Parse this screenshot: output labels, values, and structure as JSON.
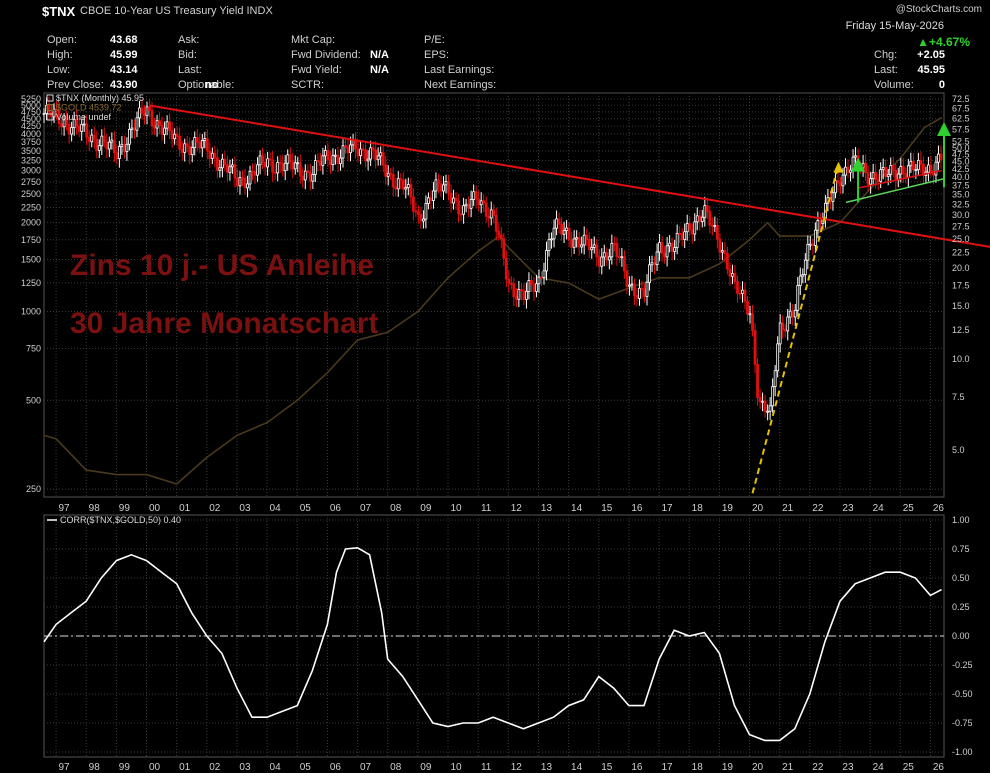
{
  "header": {
    "symbol": "$TNX",
    "description": "CBOE 10-Year US Treasury Yield INDX",
    "watermark": "@StockCharts.com",
    "date": "Friday 15-May-2026",
    "pct_change": "+4.67%",
    "col1": [
      {
        "label": "Open:",
        "value": "43.68"
      },
      {
        "label": "High:",
        "value": "45.99"
      },
      {
        "label": "Low:",
        "value": "43.14"
      },
      {
        "label": "Prev Close:",
        "value": "43.90"
      }
    ],
    "col2": [
      {
        "label": "Ask:",
        "value": ""
      },
      {
        "label": "Bid:",
        "value": ""
      },
      {
        "label": "Last:",
        "value": ""
      },
      {
        "label": "Optionable:",
        "value": "no"
      }
    ],
    "col3": [
      {
        "label": "Mkt Cap:",
        "value": ""
      },
      {
        "label": "Fwd Dividend:",
        "value": "N/A"
      },
      {
        "label": "Fwd Yield:",
        "value": "N/A"
      },
      {
        "label": "SCTR:",
        "value": ""
      }
    ],
    "col4": [
      {
        "label": "P/E:",
        "value": ""
      },
      {
        "label": "EPS:",
        "value": ""
      },
      {
        "label": "Last Earnings:",
        "value": ""
      },
      {
        "label": "Next Earnings:",
        "value": ""
      }
    ],
    "col5": [
      {
        "label": "",
        "value": ""
      },
      {
        "label": "Chg:",
        "value": "+2.05"
      },
      {
        "label": "Last:",
        "value": "45.95"
      },
      {
        "label": "Volume:",
        "value": "0"
      }
    ]
  },
  "legend": [
    {
      "text": "$TNX (Monthly) 45.95",
      "color": "#d9d9d9"
    },
    {
      "text": "$GOLD 4539.72",
      "color": "#8a6a30"
    },
    {
      "text": "Volume undef",
      "color": "#d9d9d9"
    }
  ],
  "overlay": {
    "line1": "Zins 10 j.- US Anleihe",
    "line2": "30 Jahre Monatschart",
    "color": "#7a1010"
  },
  "colors": {
    "background": "#000000",
    "grid": "#3a3a3a",
    "up_candle": "#ffffff",
    "down_candle": "#e01010",
    "trend_red": "#e01010",
    "trend_green": "#5cd65c",
    "arrow_green": "#2fd12f",
    "arrow_yellow": "#e6c200",
    "gold_line": "#4a3a1c",
    "corr_line": "#ffffff"
  },
  "chart_data": [
    {
      "type": "line",
      "title": "$TNX (Monthly)",
      "x_tick_labels": [
        "97",
        "98",
        "99",
        "00",
        "01",
        "02",
        "03",
        "04",
        "05",
        "06",
        "07",
        "08",
        "09",
        "10",
        "11",
        "12",
        "13",
        "14",
        "15",
        "16",
        "17",
        "18",
        "19",
        "20",
        "21",
        "22",
        "23",
        "24",
        "25",
        "26"
      ],
      "right_axis_ticks": [
        "72.5",
        "67.5",
        "62.5",
        "57.5",
        "52.5",
        "50.0",
        "47.5",
        "45.0",
        "42.5",
        "40.0",
        "37.5",
        "35.0",
        "32.5",
        "30.0",
        "27.5",
        "25.0",
        "22.5",
        "20.0",
        "17.5",
        "15.0",
        "12.5",
        "10.0",
        "7.5",
        "5.0"
      ],
      "left_axis_ticks": [
        "5250",
        "5000",
        "4750",
        "4500",
        "4250",
        "4000",
        "3750",
        "3500",
        "3250",
        "3000",
        "2750",
        "2500",
        "2250",
        "2000",
        "1750",
        "1500",
        "1250",
        "1000",
        "750",
        "500",
        "250"
      ],
      "series": [
        {
          "name": "$TNX",
          "x": [
            1996.6,
            1997,
            1997.5,
            1998,
            1998.5,
            1999,
            1999.5,
            2000,
            2000.5,
            2001,
            2001.5,
            2002,
            2002.5,
            2003,
            2003.5,
            2004,
            2004.5,
            2005,
            2005.5,
            2006,
            2006.5,
            2007,
            2007.5,
            2008,
            2008.5,
            2009,
            2009.5,
            2010,
            2010.5,
            2011,
            2011.5,
            2012,
            2012.5,
            2013,
            2013.5,
            2014,
            2014.5,
            2015,
            2015.5,
            2016,
            2016.5,
            2017,
            2017.5,
            2018,
            2018.5,
            2019,
            2019.5,
            2020,
            2020.3,
            2020.7,
            2021,
            2021.5,
            2022,
            2022.5,
            2023,
            2023.5,
            2024,
            2024.5,
            2025,
            2025.5,
            2026,
            2026.37
          ],
          "y": [
            65,
            63,
            60,
            55,
            53,
            47,
            58,
            66,
            59,
            52,
            51,
            50,
            44,
            39,
            41,
            45,
            44,
            43,
            41,
            47,
            48,
            50,
            48,
            41,
            38,
            29,
            36,
            37,
            30,
            35,
            29,
            18,
            16,
            18,
            27,
            26,
            24,
            22,
            23,
            18,
            16,
            24,
            23,
            28,
            30,
            25,
            17,
            15,
            7,
            6.5,
            13,
            14,
            25,
            30,
            41,
            44,
            41,
            40,
            43,
            42,
            43.5,
            45.95
          ]
        },
        {
          "name": "$GOLD",
          "x": [
            1996.6,
            1997,
            1998,
            1999,
            2000,
            2001,
            2002,
            2003,
            2004,
            2005,
            2006,
            2007,
            2008,
            2009,
            2010,
            2011,
            2011.7,
            2012,
            2013,
            2014,
            2015,
            2016,
            2017,
            2018,
            2019,
            2020,
            2020.6,
            2021,
            2022,
            2023,
            2024,
            2025,
            2025.8,
            2026.37
          ],
          "y": [
            380,
            370,
            290,
            280,
            280,
            260,
            320,
            380,
            420,
            500,
            620,
            800,
            850,
            1000,
            1300,
            1600,
            1800,
            1650,
            1300,
            1250,
            1100,
            1200,
            1300,
            1300,
            1450,
            1750,
            2000,
            1800,
            1800,
            2000,
            2600,
            3300,
            4200,
            4540
          ]
        }
      ]
    },
    {
      "type": "line",
      "title": "CORR($TNX,$GOLD,50) 0.40",
      "ylim": [
        -1.0,
        1.0
      ],
      "y_ticks": [
        "1.00",
        "0.75",
        "0.50",
        "0.25",
        "0.00",
        "-0.25",
        "-0.50",
        "-0.75",
        "-1.00"
      ],
      "series": [
        {
          "name": "CORR($TNX,$GOLD,50)",
          "x": [
            1996.6,
            1997,
            1997.5,
            1998,
            1998.5,
            1999,
            1999.5,
            2000,
            2000.5,
            2001,
            2001.5,
            2002,
            2002.5,
            2003,
            2003.5,
            2004,
            2004.5,
            2005,
            2005.5,
            2006,
            2006.3,
            2006.6,
            2007,
            2007.4,
            2007.8,
            2008,
            2008.5,
            2009,
            2009.5,
            2010,
            2010.5,
            2011,
            2011.5,
            2012,
            2012.5,
            2013,
            2013.5,
            2014,
            2014.5,
            2015,
            2015.5,
            2016,
            2016.5,
            2017,
            2017.5,
            2018,
            2018.5,
            2019,
            2019.5,
            2020,
            2020.5,
            2021,
            2021.5,
            2022,
            2022.5,
            2023,
            2023.5,
            2024,
            2024.5,
            2025,
            2025.5,
            2026,
            2026.37
          ],
          "y": [
            -0.05,
            0.1,
            0.2,
            0.3,
            0.5,
            0.65,
            0.7,
            0.65,
            0.55,
            0.45,
            0.2,
            0.0,
            -0.15,
            -0.45,
            -0.7,
            -0.7,
            -0.65,
            -0.6,
            -0.3,
            0.1,
            0.55,
            0.75,
            0.76,
            0.7,
            0.2,
            -0.2,
            -0.35,
            -0.55,
            -0.75,
            -0.78,
            -0.75,
            -0.75,
            -0.7,
            -0.75,
            -0.8,
            -0.75,
            -0.7,
            -0.6,
            -0.55,
            -0.35,
            -0.45,
            -0.6,
            -0.6,
            -0.2,
            0.05,
            0.0,
            0.03,
            -0.15,
            -0.6,
            -0.85,
            -0.9,
            -0.9,
            -0.8,
            -0.5,
            -0.05,
            0.3,
            0.45,
            0.5,
            0.55,
            0.55,
            0.5,
            0.35,
            0.4
          ]
        }
      ]
    }
  ]
}
